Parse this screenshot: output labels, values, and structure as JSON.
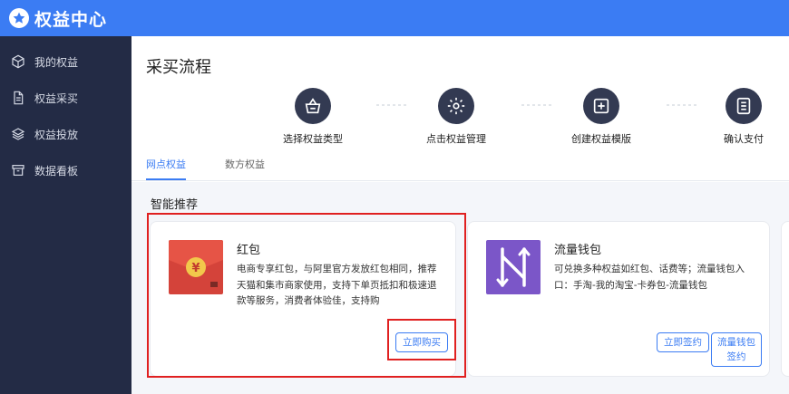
{
  "app": {
    "title": "权益中心",
    "logo_icon": "star-icon"
  },
  "sidebar": {
    "items": [
      {
        "label": "我的权益",
        "icon": "cube-icon"
      },
      {
        "label": "权益采买",
        "icon": "document-icon"
      },
      {
        "label": "权益投放",
        "icon": "layers-icon"
      },
      {
        "label": "数据看板",
        "icon": "archive-icon"
      }
    ]
  },
  "main": {
    "title": "采买流程",
    "steps": [
      {
        "label": "选择权益类型",
        "icon": "basket-icon"
      },
      {
        "label": "点击权益管理",
        "icon": "gear-icon"
      },
      {
        "label": "创建权益模版",
        "icon": "add-box-icon"
      },
      {
        "label": "确认支付",
        "icon": "list-icon"
      }
    ],
    "tabs": [
      {
        "label": "网点权益",
        "active": true
      },
      {
        "label": "数方权益",
        "active": false
      }
    ],
    "section_title": "智能推荐",
    "cards": [
      {
        "title": "红包",
        "desc": "电商专享红包，与阿里官方发放红包相同，推荐天猫和集市商家使用，支持下单页抵扣和极速退款等服务，消费者体验佳，支持购",
        "icon": "red-envelope-icon",
        "buttons": [
          "立即购买"
        ]
      },
      {
        "title": "流量钱包",
        "desc": "可兑换多种权益如红包、话费等；流量钱包入口：手淘-我的淘宝-卡券包-流量钱包",
        "icon": "flow-wallet-icon",
        "buttons": [
          "立即签约",
          "流量钱包签约"
        ]
      }
    ]
  },
  "colors": {
    "topbar": "#3b7cf3",
    "sidebar": "#232b45",
    "accent": "#3b7cf3",
    "highlight": "#e02020",
    "step_circle": "#333a52"
  }
}
